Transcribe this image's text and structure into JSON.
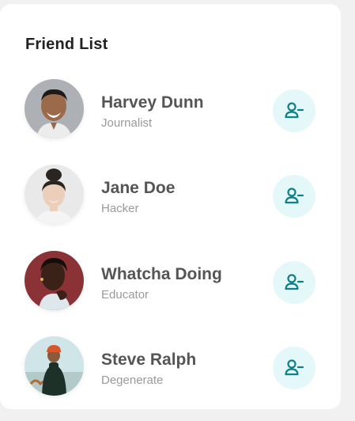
{
  "panel": {
    "title": "Friend List"
  },
  "friends": [
    {
      "name": "Harvey Dunn",
      "role": "Journalist"
    },
    {
      "name": "Jane Doe",
      "role": "Hacker"
    },
    {
      "name": "Whatcha Doing",
      "role": "Educator"
    },
    {
      "name": "Steve Ralph",
      "role": "Degenerate"
    }
  ],
  "icons": {
    "remove_friend": "user-minus-icon"
  },
  "colors": {
    "accent": "#0f7f89",
    "button_bg": "#e4f8fa",
    "name_text": "#555555",
    "role_text": "#9a9a9a"
  }
}
